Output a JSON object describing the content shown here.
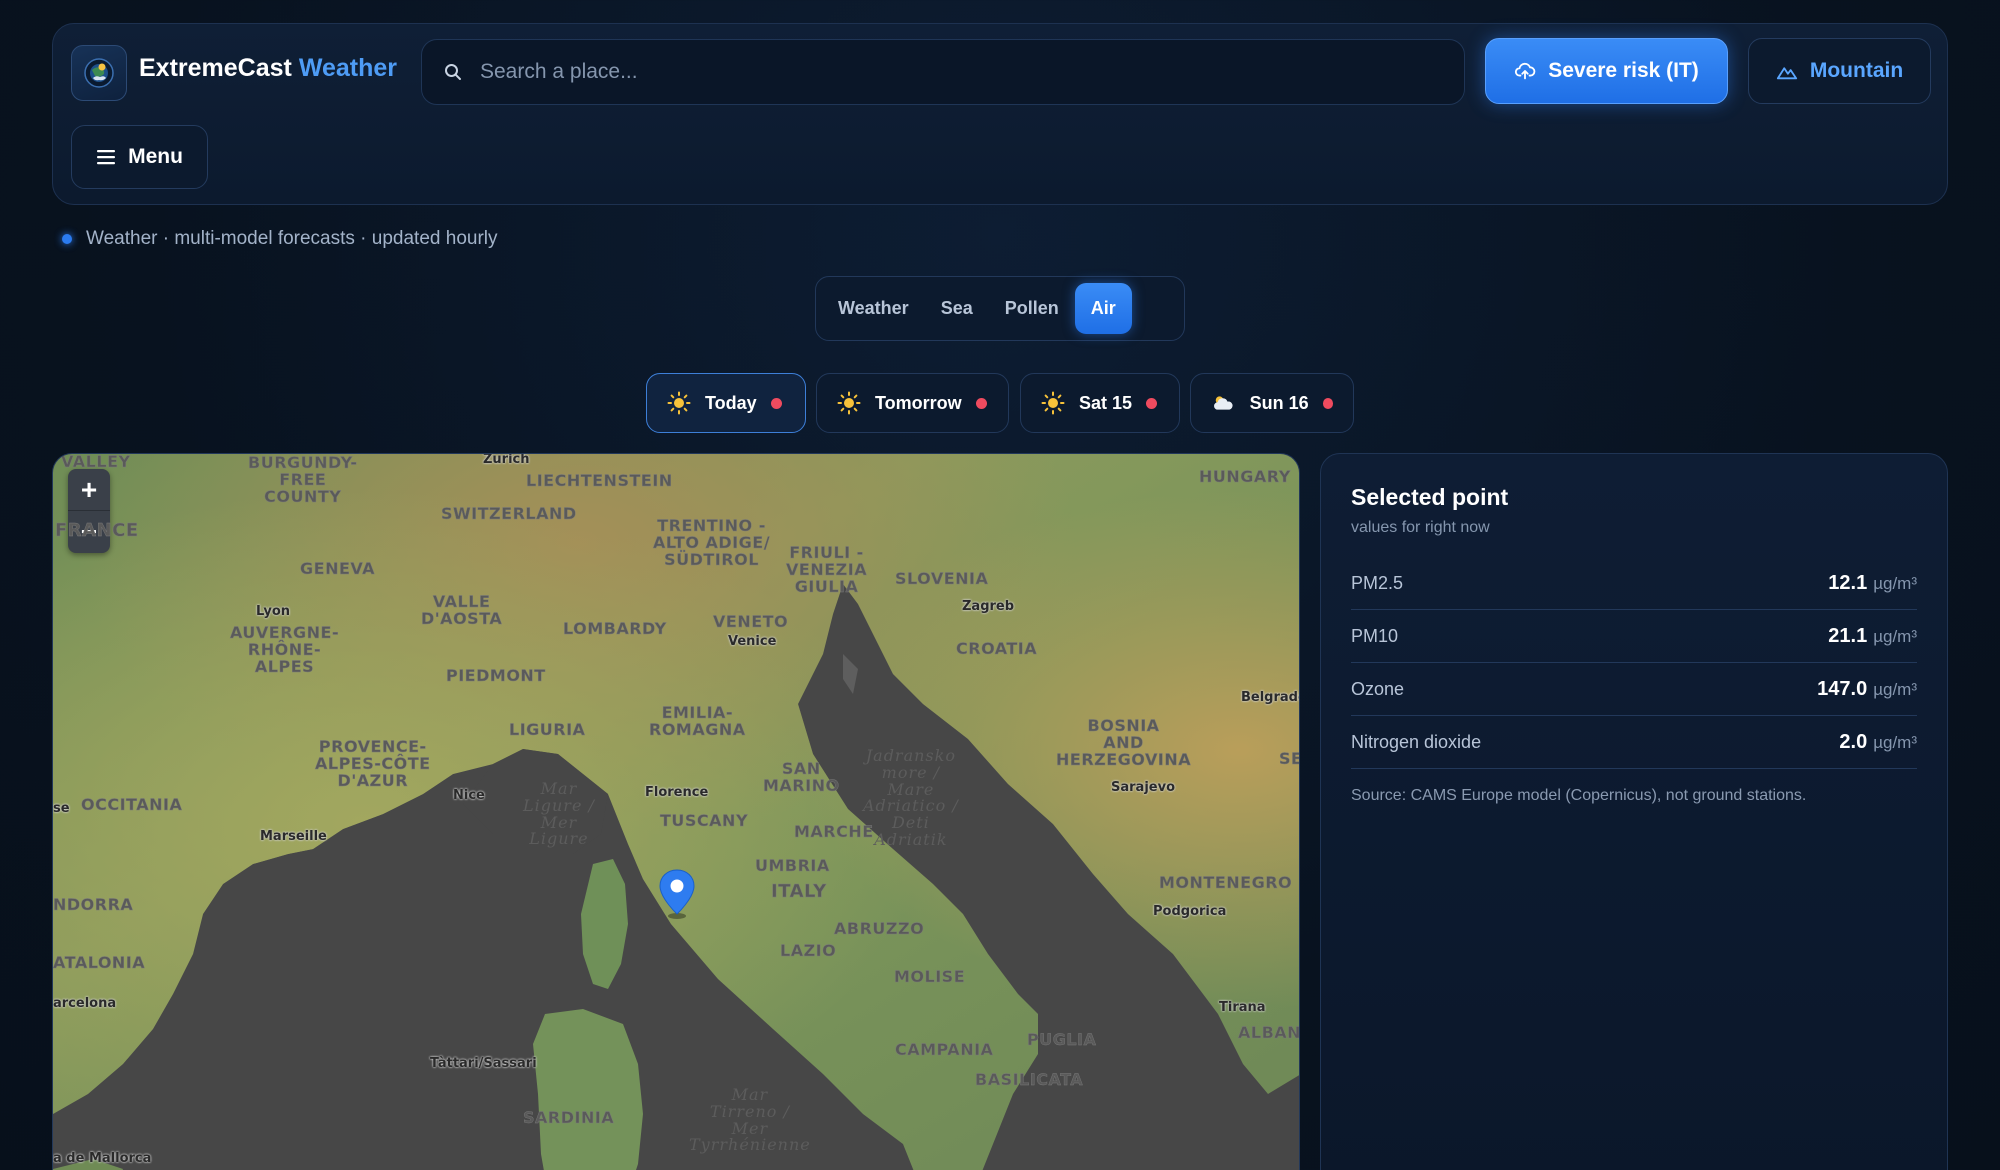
{
  "header": {
    "brand_name": "ExtremeCast",
    "brand_accent": "Weather",
    "logo_icon": "globe-weather-icon",
    "search_placeholder": "Search a place...",
    "severe_button_label": "Severe risk (IT)",
    "mountain_button_label": "Mountain",
    "menu_button_label": "Menu"
  },
  "status": {
    "text": "Weather · multi-model forecasts · updated hourly"
  },
  "modes": [
    {
      "label": "Weather",
      "active": false
    },
    {
      "label": "Sea",
      "active": false
    },
    {
      "label": "Pollen",
      "active": false
    },
    {
      "label": "Air",
      "active": true
    }
  ],
  "days": [
    {
      "label": "Today",
      "icon": "sun-icon",
      "active": true
    },
    {
      "label": "Tomorrow",
      "icon": "sun-icon",
      "active": false
    },
    {
      "label": "Sat 15",
      "icon": "sun-icon",
      "active": false
    },
    {
      "label": "Sun 16",
      "icon": "cloud-icon",
      "active": false
    }
  ],
  "map": {
    "zoom_in": "+",
    "zoom_out": "−",
    "labels": {
      "valley": "VALLEY",
      "burgundy": "BURGUNDY-\nFREE\nCOUNTY",
      "zurich": "Zurich",
      "liechtenstein": "LIECHTENSTEIN",
      "switzerland": "SWITZERLAND",
      "trentino": "TRENTINO -\nALTO ADIGE/\nSÜDTIROL",
      "friuli": "FRIULI -\nVENEZIA\nGIULIA",
      "slovenia": "SLOVENIA",
      "hungary": "HUNGARY",
      "france": "FRANCE",
      "geneva": "GENEVA",
      "valle_daosta": "VALLE\nD'AOSTA",
      "lombardy": "LOMBARDY",
      "veneto": "VENETO",
      "venice": "Venice",
      "zagreb": "Zagreb",
      "croatia": "CROATIA",
      "lyon": "Lyon",
      "auvergne": "AUVERGNE-\nRHÔNE-\nALPES",
      "piedmont": "PIEDMONT",
      "emilia": "EMILIA-\nROMAGNA",
      "belgrade": "Belgrade",
      "liguria": "LIGURIA",
      "provence": "PROVENCE-\nALPES-CÔTE\nD'AZUR",
      "bosnia": "BOSNIA\nAND\nHERZEGOVINA",
      "se": "SE",
      "san_marino": "SAN\nMARINO",
      "mar_ligure": "Mar\nLigure /\nMer\nLigure",
      "jadransko": "Jadransko\nmore /\nMare\nAdriatico /\nDeti\nAdriatik",
      "occitania": "OCCITANIA",
      "nice": "Nice",
      "florence": "Florence",
      "tuscany": "TUSCANY",
      "sarajevo": "Sarajevo",
      "se_left": "se",
      "marche": "MARCHE",
      "marseille": "Marseille",
      "umbria": "UMBRIA",
      "italy": "ITALY",
      "montenegro": "MONTENEGRO",
      "andorra": "NDORRA",
      "podgorica": "Podgorica",
      "abruzzo": "ABRUZZO",
      "lazio": "LAZIO",
      "catalonia": "ATALONIA",
      "molise": "MOLISE",
      "barcelona": "arcelona",
      "tirana": "Tirana",
      "alban": "ALBAN",
      "tattari": "Tàttari/Sassari",
      "puglia": "PUGLIA",
      "campania": "CAMPANIA",
      "basilicata": "BASILICATA",
      "sardinia": "SARDINIA",
      "mar_tirreno": "Mar\nTirreno /\nMer\nTyrrhénienne",
      "mallorca": "a de Mallorca"
    }
  },
  "panel": {
    "title": "Selected point",
    "subtitle": "values for right now",
    "rows": [
      {
        "label": "PM2.5",
        "value": "12.1",
        "unit": "µg/m³"
      },
      {
        "label": "PM10",
        "value": "21.1",
        "unit": "µg/m³"
      },
      {
        "label": "Ozone",
        "value": "147.0",
        "unit": "µg/m³"
      },
      {
        "label": "Nitrogen dioxide",
        "value": "2.0",
        "unit": "µg/m³"
      }
    ],
    "note": "Source: CAMS Europe model (Copernicus), not ground stations."
  },
  "colors": {
    "accent": "#2b7bf0",
    "brand_accent": "#4e9cf5",
    "risk_dot": "#ef4b5f",
    "sea": "#474747"
  }
}
